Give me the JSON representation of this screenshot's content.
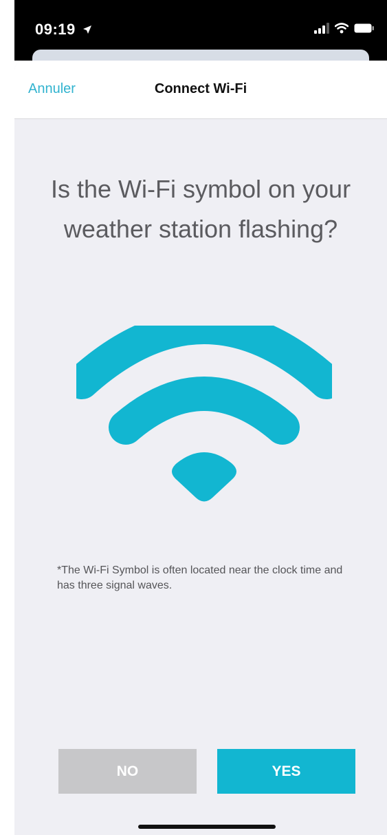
{
  "status_bar": {
    "time": "09:19",
    "location_icon": "location-arrow-icon",
    "signal_icon": "cellular-signal-icon",
    "wifi_icon": "wifi-status-icon",
    "battery_icon": "battery-icon"
  },
  "nav": {
    "cancel_label": "Annuler",
    "title": "Connect Wi-Fi"
  },
  "content": {
    "question": "Is the Wi-Fi symbol on your weather station flashing?",
    "illustration_icon": "wifi-symbol-icon",
    "note": "*The Wi-Fi Symbol is often located near the clock time and has three signal waves."
  },
  "actions": {
    "no_label": "NO",
    "yes_label": "YES"
  },
  "colors": {
    "accent": "#12b6d1",
    "link": "#31b3cf",
    "disabled_button": "#c7c7c9",
    "background": "#efeff4",
    "text": "#5b5b5f"
  }
}
